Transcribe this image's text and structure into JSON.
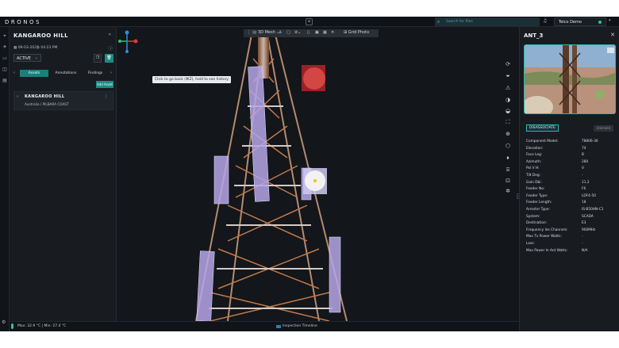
{
  "app": {
    "logo": "DRONOS",
    "search_placeholder": "Search for files",
    "user_name": "Telco Demo"
  },
  "left_panel": {
    "title": "KANGAROO HILL",
    "date": "09-03-2023",
    "time": "04:23 PM",
    "status": "ACTIVE",
    "tabs": [
      "Assets",
      "Annotations",
      "Findings"
    ],
    "active_tab": "Assets",
    "add_asset_label": "Add Asset",
    "tree": {
      "title": "KANGAROO HILL",
      "subtitle": "Australia / PILBARA COAST"
    }
  },
  "viewport": {
    "toolbar": {
      "mesh_label": "3D Mesh",
      "grid_photo_label": "Grid Photo"
    },
    "tooltip": "Click to go back (⌘Z), hold to see history",
    "tools": [
      "refresh-icon",
      "filter-icon",
      "measure-icon",
      "layer-icon",
      "layer-alt-icon",
      "crop-icon",
      "target-icon",
      "cube-icon",
      "compass-icon",
      "camera-icon",
      "camera-alt-icon",
      "settings-icon"
    ]
  },
  "bottom_bar": {
    "temperature": "Max: 32.9 °C | Min: 27.4 °C",
    "timeline": "Inspection Timeline"
  },
  "right_panel": {
    "title": "ANT_3",
    "disassociate_label": "DISASSOCIATE",
    "edit_label": "Unlinked",
    "properties": [
      {
        "k": "Component Model:",
        "v": "T8806-36"
      },
      {
        "k": "Elevation:",
        "v": "74"
      },
      {
        "k": "Face Leg:",
        "v": "B"
      },
      {
        "k": "Azimuth:",
        "v": "280"
      },
      {
        "k": "Pol V H:",
        "v": "V"
      },
      {
        "k": "Tilt Deg:",
        "v": "-"
      },
      {
        "k": "Gain Dbi:",
        "v": "11.2"
      },
      {
        "k": "Feeder No:",
        "v": "F6"
      },
      {
        "k": "Feeder Type:",
        "v": "LDF4-50"
      },
      {
        "k": "Feeder Length:",
        "v": "18"
      },
      {
        "k": "Arrester Type:",
        "v": "IS-B50HN-C1"
      },
      {
        "k": "System:",
        "v": "SCADA"
      },
      {
        "k": "Destination:",
        "v": "E3"
      },
      {
        "k": "Frequency Ies Channels:",
        "v": "900MHz"
      },
      {
        "k": "Max Tx Power Watts:",
        "v": "-"
      },
      {
        "k": "Loss:",
        "v": "-"
      },
      {
        "k": "Max Power In Ant Watts:",
        "v": "N/A"
      }
    ]
  },
  "colors": {
    "accent": "#1d8a85",
    "highlight_selected": "#f3f1f1",
    "highlight_alert": "#c0262d",
    "component_overlay": "#b6a6e8"
  }
}
